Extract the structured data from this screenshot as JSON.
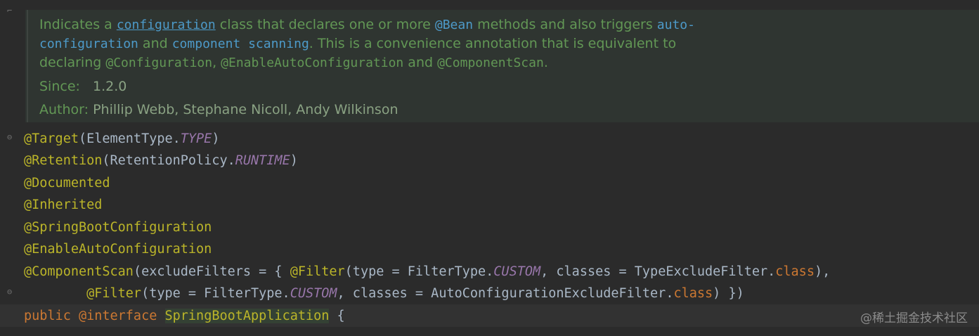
{
  "doc": {
    "line1": {
      "t1": "Indicates a ",
      "link": "configuration",
      "t2": " class that declares one or more ",
      "bean": "@Bean",
      "t3": " methods and also triggers ",
      "auto": "auto-"
    },
    "line2": {
      "autoconf": "configuration",
      "t1": " and ",
      "component": "component scanning",
      "t2": ". This is a convenience annotation that is equivalent to"
    },
    "line3": {
      "t1": "declaring ",
      "c1": "@Configuration",
      "t2": ", ",
      "c2": "@EnableAutoConfiguration",
      "t3": " and ",
      "c3": "@ComponentScan",
      "t4": "."
    },
    "since_label": "Since:",
    "since_value": "1.2.0",
    "author_label": "Author:",
    "author_value": "Phillip Webb, Stephane Nicoll, Andy Wilkinson"
  },
  "code": {
    "l1": {
      "ann": "@Target",
      "t1": "(ElementType.",
      "it": "TYPE",
      "t2": ")"
    },
    "l2": {
      "ann": "@Retention",
      "t1": "(RetentionPolicy.",
      "it": "RUNTIME",
      "t2": ")"
    },
    "l3": {
      "ann": "@Documented"
    },
    "l4": {
      "ann": "@Inherited"
    },
    "l5": {
      "ann": "@SpringBootConfiguration"
    },
    "l6": {
      "ann": "@EnableAutoConfiguration"
    },
    "l7": {
      "ann": "@ComponentScan",
      "t1": "(excludeFilters = { ",
      "ann2": "@Filter",
      "t2": "(type = FilterType.",
      "it": "CUSTOM",
      "t3": ", classes = TypeExcludeFilter.",
      "kw": "class",
      "t4": "),"
    },
    "l8": {
      "indent": "        ",
      "ann": "@Filter",
      "t1": "(type = FilterType.",
      "it": "CUSTOM",
      "t2": ", classes = AutoConfigurationExcludeFilter.",
      "kw": "class",
      "t3": ") })"
    },
    "l9": {
      "kw1": "public",
      "kw2": "@interface",
      "name": "SpringBootApplication",
      "brace": "{"
    }
  },
  "watermark": "@稀土掘金技术社区",
  "colors": {
    "background": "#2b2b2b",
    "doc_background": "#2f3531",
    "doc_text": "#629755",
    "link": "#4d9ac9",
    "annotation": "#bbb529",
    "keyword": "#cc7832",
    "constant": "#9876aa",
    "plain": "#a9b7c6"
  }
}
